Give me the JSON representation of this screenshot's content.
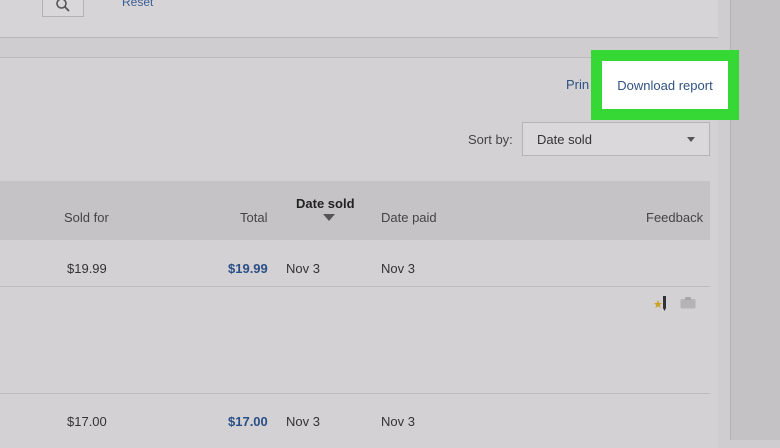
{
  "top_panel": {
    "reset_label": "Reset"
  },
  "actions": {
    "print_label": "Prin",
    "download_label": "Download report"
  },
  "sort": {
    "label": "Sort by:",
    "selected": "Date sold"
  },
  "table": {
    "headers": {
      "sold_for": "Sold for",
      "total": "Total",
      "date_sold": "Date sold",
      "date_paid": "Date paid",
      "feedback": "Feedback"
    },
    "rows": [
      {
        "sold_for": "$19.99",
        "total": "$19.99",
        "date_sold": "Nov 3",
        "date_paid": "Nov 3"
      },
      {
        "sold_for": "$17.00",
        "total": "$17.00",
        "date_sold": "Nov 3",
        "date_paid": "Nov 3"
      }
    ]
  },
  "icons": {
    "search": "search-icon",
    "dropdown": "chevron-down-icon",
    "sort_indicator": "sort-descending-icon",
    "leave_feedback": "star-pencil-icon",
    "shipping": "package-icon"
  },
  "colors": {
    "highlight": "#35d835",
    "link": "#2f5283"
  }
}
